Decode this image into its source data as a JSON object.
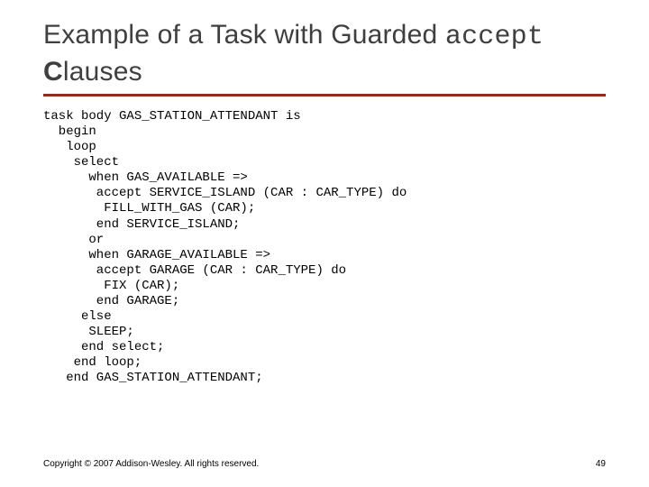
{
  "title": {
    "part1": "Example of a Task with Guarded ",
    "mono": "accept",
    "part2_bold": "C",
    "part2_rest": "lauses"
  },
  "code": "task body GAS_STATION_ATTENDANT is\n  begin\n   loop\n    select\n      when GAS_AVAILABLE =>\n       accept SERVICE_ISLAND (CAR : CAR_TYPE) do\n        FILL_WITH_GAS (CAR);\n       end SERVICE_ISLAND;\n      or\n      when GARAGE_AVAILABLE =>\n       accept GARAGE (CAR : CAR_TYPE) do\n        FIX (CAR);\n       end GARAGE;\n     else\n      SLEEP;\n     end select;\n    end loop;\n   end GAS_STATION_ATTENDANT;",
  "footer": {
    "copyright": "Copyright © 2007 Addison-Wesley. All rights reserved.",
    "page": "49"
  }
}
